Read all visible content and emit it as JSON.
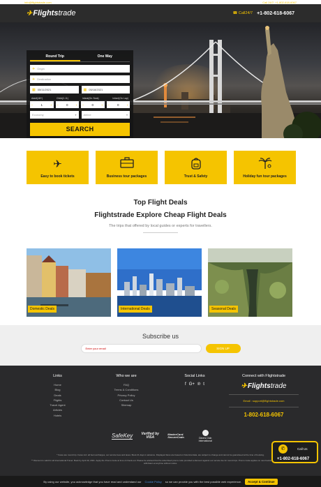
{
  "topbar": {
    "email": "info@flightstrade.com",
    "right": "Call 24/7: +1-802-618-6067"
  },
  "header": {
    "logo_bold": "Flights",
    "logo_thin": "trade",
    "call_label": "Call24/7",
    "phone": "+1-802-618-6067"
  },
  "search": {
    "tabs": [
      {
        "label": "Round Trip",
        "active": true
      },
      {
        "label": "One Way",
        "active": false
      }
    ],
    "origin_placeholder": "Origin",
    "destination_placeholder": "Destination",
    "depart_date": "05/11/2021",
    "return_date": "05/18/2021",
    "pax_labels": [
      "Adult(18+)",
      "Child(2-11)",
      "Infant(On Seat)",
      "Infant(On Lap)"
    ],
    "pax_values": [
      "1",
      "0",
      "0",
      "0"
    ],
    "class_value": "Economy",
    "airline_value": "Airline",
    "search_label": "SEARCH"
  },
  "features": [
    {
      "icon": "plane-icon",
      "label": "Easy to book tickets"
    },
    {
      "icon": "briefcase-icon",
      "label": "Business tour packages"
    },
    {
      "icon": "backpack-icon",
      "label": "Trust & Safety"
    },
    {
      "icon": "palm-tree-icon",
      "label": "Holiday fun tour packages"
    }
  ],
  "deals_section": {
    "title": "Top Flight Deals",
    "subtitle": "Flightstrade Explore Cheap Flight Deals",
    "tagline": "The trips that offered by local guides or experts for travellers."
  },
  "deals": [
    {
      "label": "Domestic Deals"
    },
    {
      "label": "International Deals"
    },
    {
      "label": "Seasonal Deals"
    }
  ],
  "subscribe": {
    "title": "Subscribe us",
    "placeholder": "Enter your email",
    "button": "SIGN UP"
  },
  "footer": {
    "links_title": "Links",
    "links": [
      "Home",
      "Blog",
      "Deals",
      "Flights",
      "Travel Agent",
      "Articles",
      "Hotels"
    ],
    "who_title": "Who we are",
    "who": [
      "FAQ",
      "Terms & Conditions",
      "Privacy Policy",
      "Contact Us",
      "Sitemap"
    ],
    "social_title": "Social Links",
    "social_icons": [
      "f",
      "G+",
      "℗",
      "t"
    ],
    "connect_title": "Connect with Flightstrade",
    "email_text": "Email : support@flightstrade.com",
    "phone": "1-802-618-6067",
    "badges": {
      "safekey": "SafeKey",
      "verified": "Verified by VISA",
      "mastercard": "MasterCard. SecureCode.",
      "diners": "Diners Club International"
    },
    "fine_1": "* Fares are round trip. Fares incl. all fuel surcharges, our service fees and taxes. Book 21 days in advance. Displayed fares are based on historical data, are subject to change and cannot be guaranteed at the time of booking.",
    "fine_2": "** Discount is valid for all International Travel. Book by April 30, 2021. Apply the Promo Code at time of check-out. Please be advised that the advertised promo code provided a discount against our service fee for round trips. Promo Code applies on new bookings only and may be withdrawn at anytime without notice."
  },
  "cookie": {
    "text": "By using our website, you acknowledge that you have read and understand our",
    "link": "Cookie Policy",
    "text2": "so we can provide you with the best possible web experience.",
    "button": "Accept & Continue"
  },
  "float_call": {
    "label": "Call Us",
    "phone": "+1-802-618-6067"
  },
  "colors": {
    "accent": "#f5c400",
    "dark": "#2c2c2c"
  }
}
